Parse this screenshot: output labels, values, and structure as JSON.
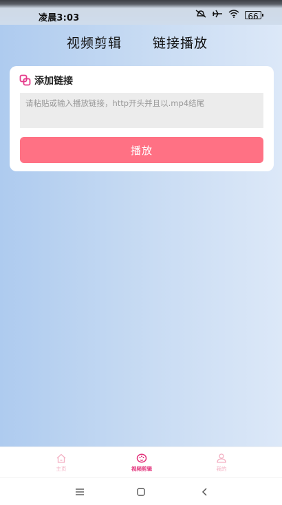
{
  "status": {
    "time": "凌晨3:03",
    "battery": "66"
  },
  "header": {
    "tab_video_edit": "视频剪辑",
    "tab_link_play": "链接播放"
  },
  "card": {
    "title": "添加链接",
    "input_placeholder": "请粘贴或输入播放链接，http开头并且以.mp4结尾",
    "input_value": "",
    "play_label": "播放"
  },
  "tabbar": {
    "items": [
      {
        "label": "主页",
        "icon": "home-icon",
        "active": false
      },
      {
        "label": "视频剪辑",
        "icon": "palette-icon",
        "active": true
      },
      {
        "label": "我的",
        "icon": "user-icon",
        "active": false
      }
    ]
  },
  "colors": {
    "accent": "#ff7184",
    "active_tab": "#e22f79",
    "inactive_tab": "#f3b0c3"
  }
}
